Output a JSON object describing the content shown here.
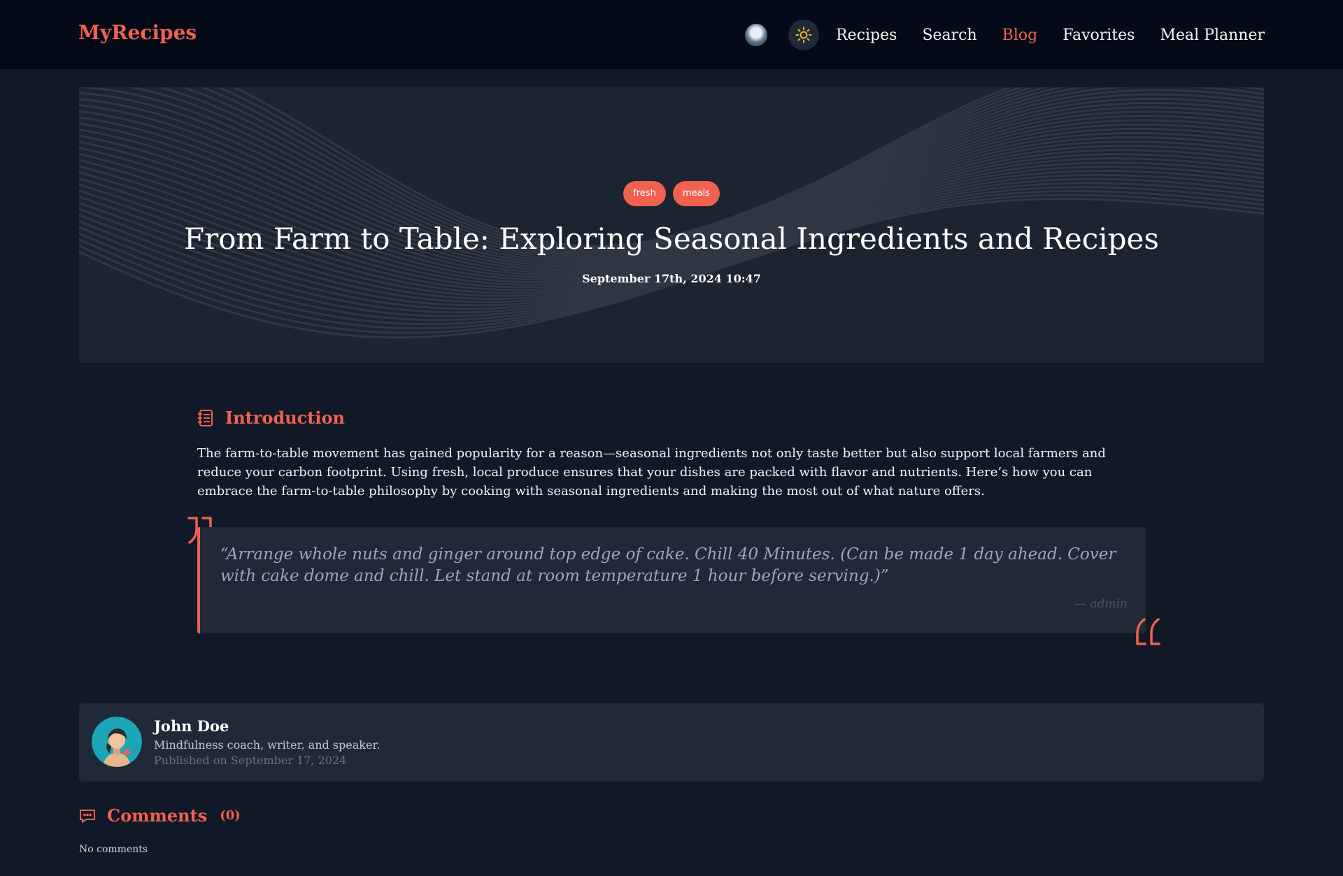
{
  "brand": {
    "logo": "MyRecipes",
    "accent": "#f0614f"
  },
  "nav": {
    "items": [
      {
        "label": "Recipes",
        "active": false
      },
      {
        "label": "Search",
        "active": false
      },
      {
        "label": "Blog",
        "active": true
      },
      {
        "label": "Favorites",
        "active": false
      },
      {
        "label": "Meal Planner",
        "active": false
      }
    ],
    "user_avatar_icon": "user-avatar",
    "theme_toggle_icon": "sun-icon"
  },
  "post": {
    "tags": [
      "fresh",
      "meals"
    ],
    "title": "From Farm to Table: Exploring Seasonal Ingredients and Recipes",
    "date": "September 17th, 2024 10:47",
    "intro": {
      "heading": "Introduction",
      "icon": "notebook-icon",
      "text": "The farm-to-table movement has gained popularity for a reason—seasonal ingredients not only taste better but also support local farmers and reduce your carbon footprint. Using fresh, local produce ensures that your dishes are packed with flavor and nutrients. Here’s how you can embrace the farm-to-table philosophy by cooking with seasonal ingredients and making the most out of what nature offers."
    },
    "quote": {
      "text": "“Arrange whole nuts and ginger around top edge of cake. Chill 40 Minutes. (Can be made 1 day ahead. Cover with cake dome and chill. Let stand at room temperature 1 hour before serving.)”",
      "author": "— admin"
    }
  },
  "author": {
    "name": "John Doe",
    "bio": "Mindfulness coach, writer, and speaker.",
    "published": "Published on September 17, 2024"
  },
  "comments": {
    "heading": "Comments",
    "count": "(0)",
    "empty_text": "No comments"
  }
}
